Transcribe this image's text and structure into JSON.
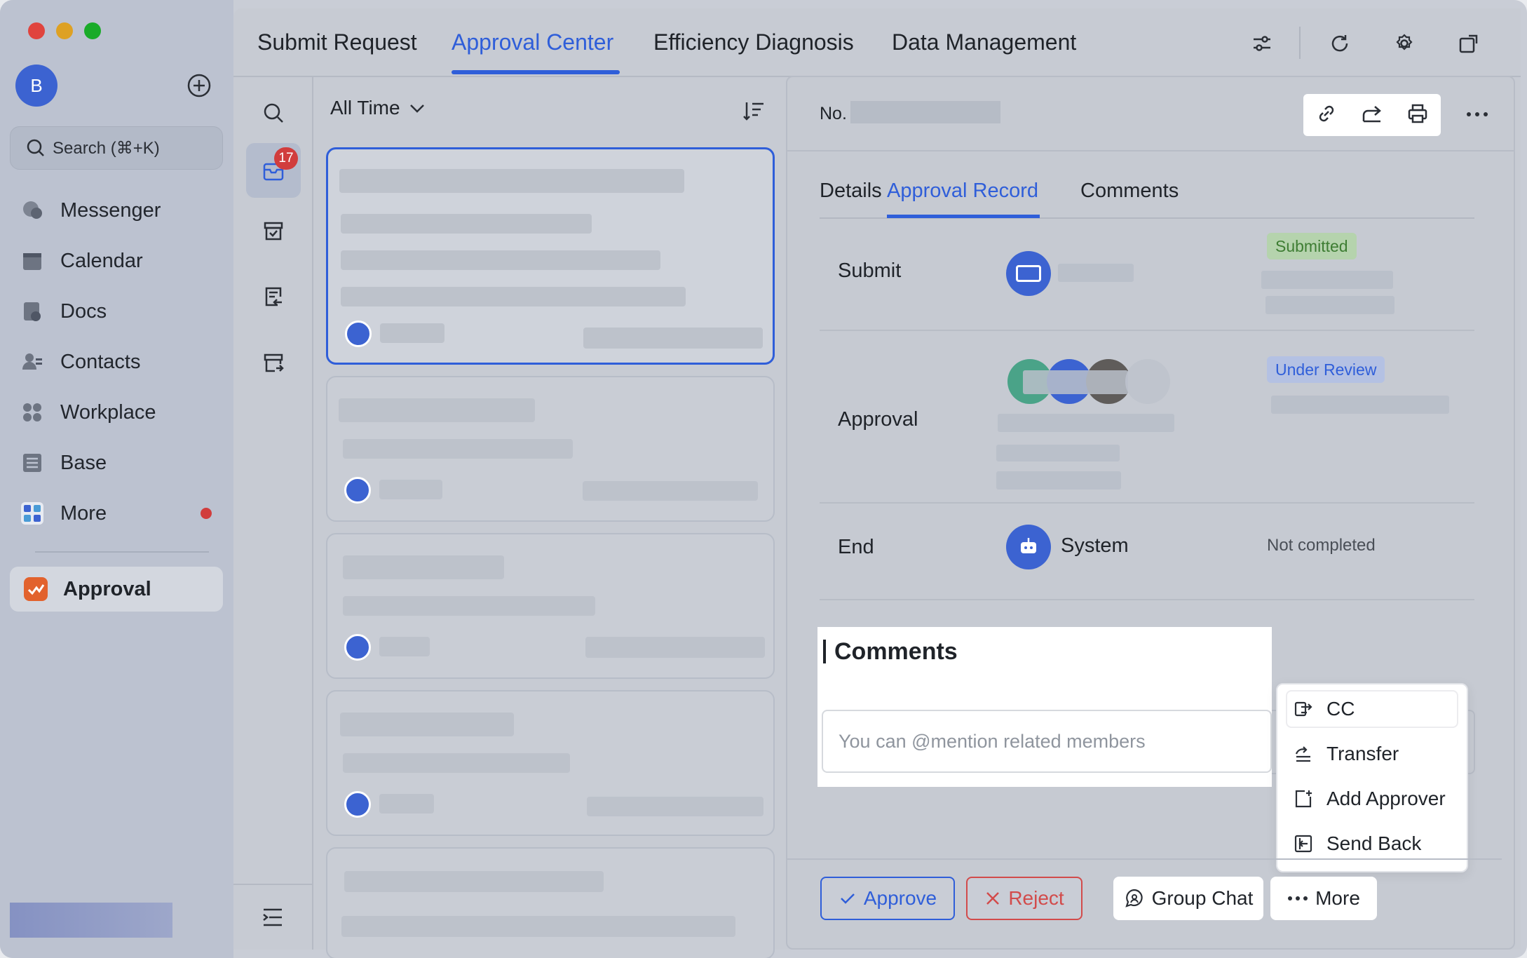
{
  "window": {
    "traffic_lights": [
      "#e0443e",
      "#dea123",
      "#1aab29"
    ]
  },
  "sidebar": {
    "avatar_letter": "B",
    "search_placeholder": "Search (⌘+K)",
    "items": [
      {
        "label": "Messenger",
        "icon": "messenger-icon"
      },
      {
        "label": "Calendar",
        "icon": "calendar-icon"
      },
      {
        "label": "Docs",
        "icon": "docs-icon"
      },
      {
        "label": "Contacts",
        "icon": "contacts-icon"
      },
      {
        "label": "Workplace",
        "icon": "workplace-icon"
      },
      {
        "label": "Base",
        "icon": "base-icon"
      },
      {
        "label": "More",
        "icon": "more-apps-icon"
      }
    ],
    "active_app": "Approval"
  },
  "topnav": {
    "tabs": [
      "Submit Request",
      "Approval Center",
      "Efficiency Diagnosis",
      "Data Management"
    ],
    "active_tab": "Approval Center"
  },
  "rail": {
    "pending_count": "17"
  },
  "list": {
    "filter_label": "All Time"
  },
  "detail": {
    "no_label": "No.",
    "tabs": [
      "Details",
      "Approval Record",
      "Comments"
    ],
    "active_tab": "Approval Record",
    "steps": {
      "submit": {
        "label": "Submit",
        "status": "Submitted"
      },
      "approval": {
        "label": "Approval",
        "status": "Under Review"
      },
      "end": {
        "label": "End",
        "actor": "System",
        "status": "Not completed"
      }
    },
    "comments": {
      "title": "Comments",
      "placeholder": "You can @mention related members"
    }
  },
  "more_menu": {
    "items": [
      "CC",
      "Transfer",
      "Add Approver",
      "Send Back"
    ]
  },
  "actions": {
    "approve": "Approve",
    "reject": "Reject",
    "group_chat": "Group Chat",
    "more": "More"
  },
  "colors": {
    "accent": "#2f5ed9",
    "reject": "#d24b4b",
    "badge": "#d13d3d",
    "submitted": "#3e7d33"
  }
}
